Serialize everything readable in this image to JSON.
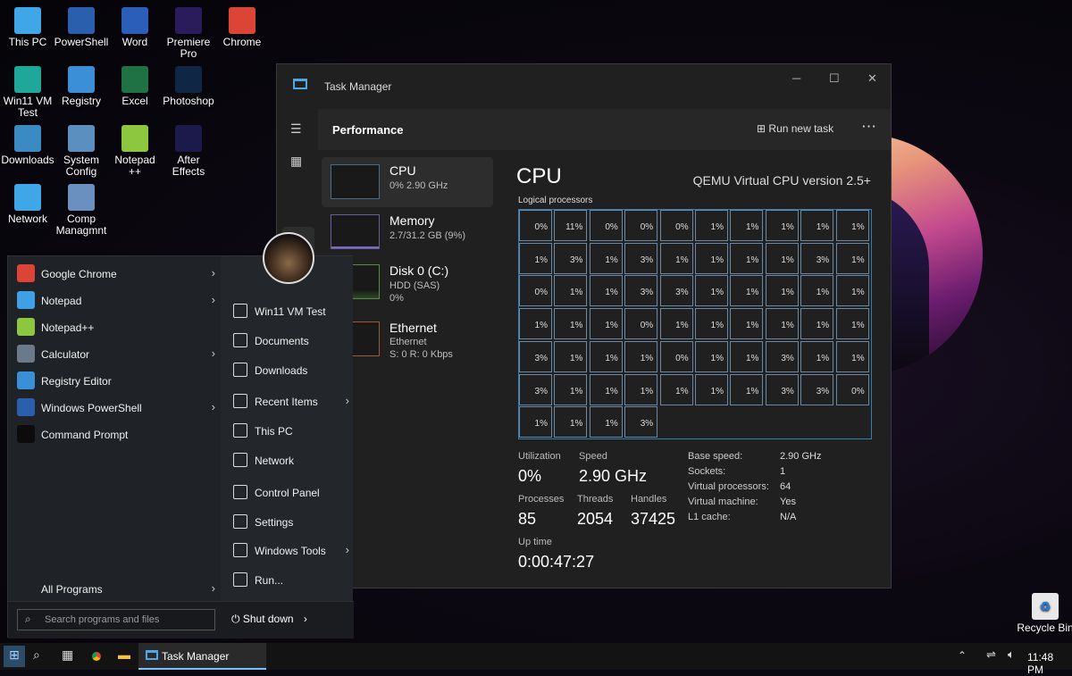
{
  "desktop": {
    "icons": [
      {
        "label": "This PC",
        "icon": "monitor-icon",
        "color": "#3fa7e8"
      },
      {
        "label": "PowerShell",
        "icon": "powershell-icon",
        "color": "#2a5fae"
      },
      {
        "label": "Word",
        "icon": "word-icon",
        "color": "#2b5eb8"
      },
      {
        "label": "Premiere Pro",
        "icon": "premiere-icon",
        "color": "#2a1b5a"
      },
      {
        "label": "Chrome",
        "icon": "chrome-icon",
        "color": "#db4437"
      },
      {
        "label": "Win11 VM Test",
        "icon": "folder-icon",
        "color": "#1fa89a"
      },
      {
        "label": "Registry",
        "icon": "registry-icon",
        "color": "#3b8fd6"
      },
      {
        "label": "Excel",
        "icon": "excel-icon",
        "color": "#1f7244"
      },
      {
        "label": "Photoshop",
        "icon": "photoshop-icon",
        "color": "#0f2745"
      },
      {
        "label": "Downloads",
        "icon": "globe-download-icon",
        "color": "#3a8ac4"
      },
      {
        "label": "System Config",
        "icon": "system-config-icon",
        "color": "#5a8fc0"
      },
      {
        "label": "Notepad ++",
        "icon": "notepad-plus-icon",
        "color": "#8dc63f"
      },
      {
        "label": "After Effects",
        "icon": "after-effects-icon",
        "color": "#1c1a4a"
      },
      {
        "label": "Network",
        "icon": "network-icon",
        "color": "#3fa7e8"
      },
      {
        "label": "Comp Managmnt",
        "icon": "computer-management-icon",
        "color": "#6a90c0"
      }
    ],
    "recycle_bin": "Recycle Bin"
  },
  "task_manager": {
    "title": "Task Manager",
    "page": "Performance",
    "run_new_task": "Run new task",
    "resources": [
      {
        "name": "CPU",
        "line1": "0% 2.90 GHz",
        "line2": ""
      },
      {
        "name": "Memory",
        "line1": "2.7/31.2 GB (9%)",
        "line2": ""
      },
      {
        "name": "Disk 0 (C:)",
        "line1": "HDD (SAS)",
        "line2": "0%"
      },
      {
        "name": "Ethernet",
        "line1": "Ethernet",
        "line2": "S: 0 R: 0 Kbps"
      }
    ],
    "cpu_title": "CPU",
    "cpu_model": "QEMU Virtual CPU version 2.5+",
    "logical_label": "Logical processors",
    "logical": [
      "0%",
      "11%",
      "0%",
      "0%",
      "0%",
      "1%",
      "1%",
      "1%",
      "1%",
      "1%",
      "1%",
      "3%",
      "1%",
      "3%",
      "1%",
      "1%",
      "1%",
      "1%",
      "3%",
      "1%",
      "0%",
      "1%",
      "1%",
      "3%",
      "3%",
      "1%",
      "1%",
      "1%",
      "1%",
      "1%",
      "1%",
      "1%",
      "1%",
      "0%",
      "1%",
      "1%",
      "1%",
      "1%",
      "1%",
      "1%",
      "3%",
      "1%",
      "1%",
      "1%",
      "0%",
      "1%",
      "1%",
      "3%",
      "1%",
      "1%",
      "3%",
      "1%",
      "1%",
      "1%",
      "1%",
      "1%",
      "1%",
      "3%",
      "3%",
      "0%",
      "1%",
      "1%",
      "1%",
      "3%"
    ],
    "stats": {
      "utilization_label": "Utilization",
      "utilization": "0%",
      "speed_label": "Speed",
      "speed": "2.90 GHz",
      "processes_label": "Processes",
      "processes": "85",
      "threads_label": "Threads",
      "threads": "2054",
      "handles_label": "Handles",
      "handles": "37425",
      "uptime_label": "Up time",
      "uptime": "0:00:47:27"
    },
    "details": [
      {
        "k": "Base speed:",
        "v": "2.90 GHz"
      },
      {
        "k": "Sockets:",
        "v": "1"
      },
      {
        "k": "Virtual processors:",
        "v": "64"
      },
      {
        "k": "Virtual machine:",
        "v": "Yes"
      },
      {
        "k": "L1 cache:",
        "v": "N/A"
      }
    ]
  },
  "start_menu": {
    "programs": [
      {
        "label": "Google Chrome",
        "icon": "chrome-icon",
        "color": "#db4437",
        "arrow": "›"
      },
      {
        "label": "Notepad",
        "icon": "notepad-icon",
        "color": "#3fa0e8",
        "arrow": "›"
      },
      {
        "label": "Notepad++",
        "icon": "notepad-plus-icon",
        "color": "#8dc63f",
        "arrow": ""
      },
      {
        "label": "Calculator",
        "icon": "calculator-icon",
        "color": "#6a7a8a",
        "arrow": "›"
      },
      {
        "label": "Registry Editor",
        "icon": "registry-icon",
        "color": "#3b8fd6",
        "arrow": ""
      },
      {
        "label": "Windows PowerShell",
        "icon": "powershell-icon",
        "color": "#2a5fae",
        "arrow": "›"
      },
      {
        "label": "Command Prompt",
        "icon": "command-prompt-icon",
        "color": "#0c0c0c",
        "arrow": ""
      }
    ],
    "all_programs": "All Programs",
    "places": [
      {
        "label": "Win11 VM Test",
        "icon": "user-folder-icon",
        "arrow": ""
      },
      {
        "label": "Documents",
        "icon": "document-icon",
        "arrow": ""
      },
      {
        "label": "Downloads",
        "icon": "download-icon",
        "arrow": ""
      },
      {
        "label": "Recent Items",
        "icon": "clock-icon",
        "arrow": "›"
      },
      {
        "label": "This PC",
        "icon": "computer-icon",
        "arrow": ""
      },
      {
        "label": "Network",
        "icon": "network-icon",
        "arrow": ""
      },
      {
        "label": "Control Panel",
        "icon": "control-panel-icon",
        "arrow": ""
      },
      {
        "label": "Settings",
        "icon": "gear-icon",
        "arrow": ""
      },
      {
        "label": "Windows Tools",
        "icon": "tools-icon",
        "arrow": "›"
      },
      {
        "label": "Run...",
        "icon": "run-icon",
        "arrow": ""
      }
    ],
    "search_placeholder": "Search programs and files",
    "shutdown": "Shut down"
  },
  "taskbar": {
    "active_app": "Task Manager",
    "time": "11:48 PM"
  }
}
